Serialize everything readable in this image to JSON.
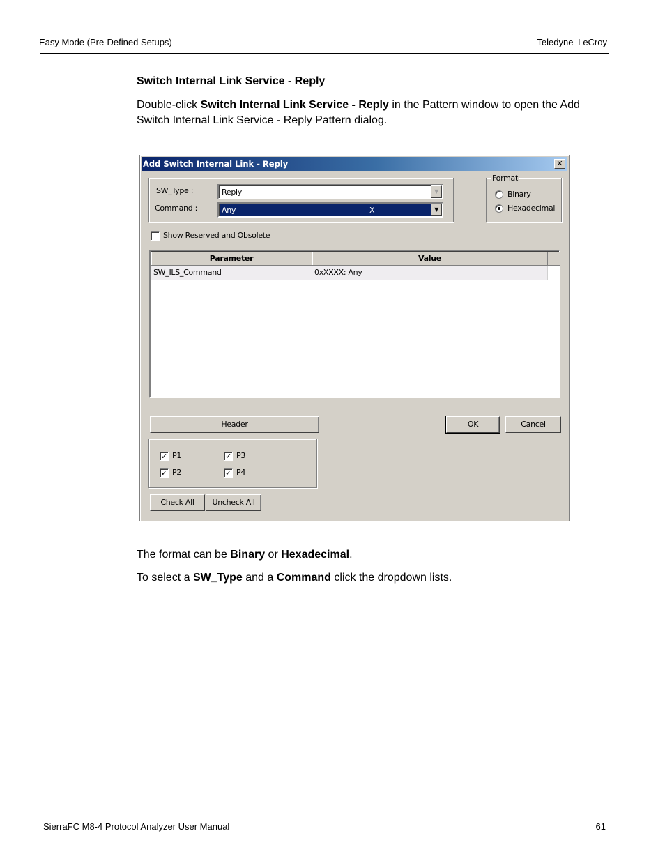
{
  "page": {
    "running_head_left": "Easy Mode (Pre-Defined Setups)",
    "running_head_right": "Teledyne LeCroy",
    "section_title": "Switch Internal Link Service - Reply",
    "intro": {
      "p1": "Double-click ",
      "b1": "Switch Internal Link Service - Reply",
      "p2": " in the Pattern window to open the Add Switch Internal Link Service - Reply Pattern dialog."
    },
    "format_note": {
      "p1": "The format can be ",
      "b1": "Binary",
      "p2": " or ",
      "b2": "Hexadecimal",
      "p3": "."
    },
    "select_note": {
      "p1": "To select a ",
      "b1": "SW_Type",
      "p2": " and a ",
      "b2": "Command",
      "p3": " click the dropdown lists."
    },
    "footer_left": "SierraFC M8-4 Protocol Analyzer User Manual",
    "footer_right": "61"
  },
  "dialog": {
    "title": "Add Switch Internal Link - Reply",
    "close_glyph": "✕",
    "sw_type_label": "SW_Type :",
    "sw_type_value": "Reply",
    "command_label": "Command :",
    "command_value": "Any",
    "command_mask": "X",
    "dropdown_glyph": "▼",
    "format": {
      "legend": "Format",
      "options": [
        {
          "label": "Binary",
          "selected": false
        },
        {
          "label": "Hexadecimal",
          "selected": true
        }
      ]
    },
    "show_reserved_label": "Show Reserved and Obsolete",
    "show_reserved_checked": false,
    "table": {
      "columns": [
        "Parameter",
        "Value"
      ],
      "rows": [
        {
          "parameter": "SW_ILS_Command",
          "value": "0xXXXX: Any"
        }
      ]
    },
    "header_button": "Header",
    "ok_button": "OK",
    "cancel_button": "Cancel",
    "ports": [
      {
        "label": "P1",
        "checked": true
      },
      {
        "label": "P2",
        "checked": true
      },
      {
        "label": "P3",
        "checked": true
      },
      {
        "label": "P4",
        "checked": true
      }
    ],
    "check_glyph": "✓",
    "check_all_button": "Check All",
    "uncheck_all_button": "Uncheck All"
  }
}
